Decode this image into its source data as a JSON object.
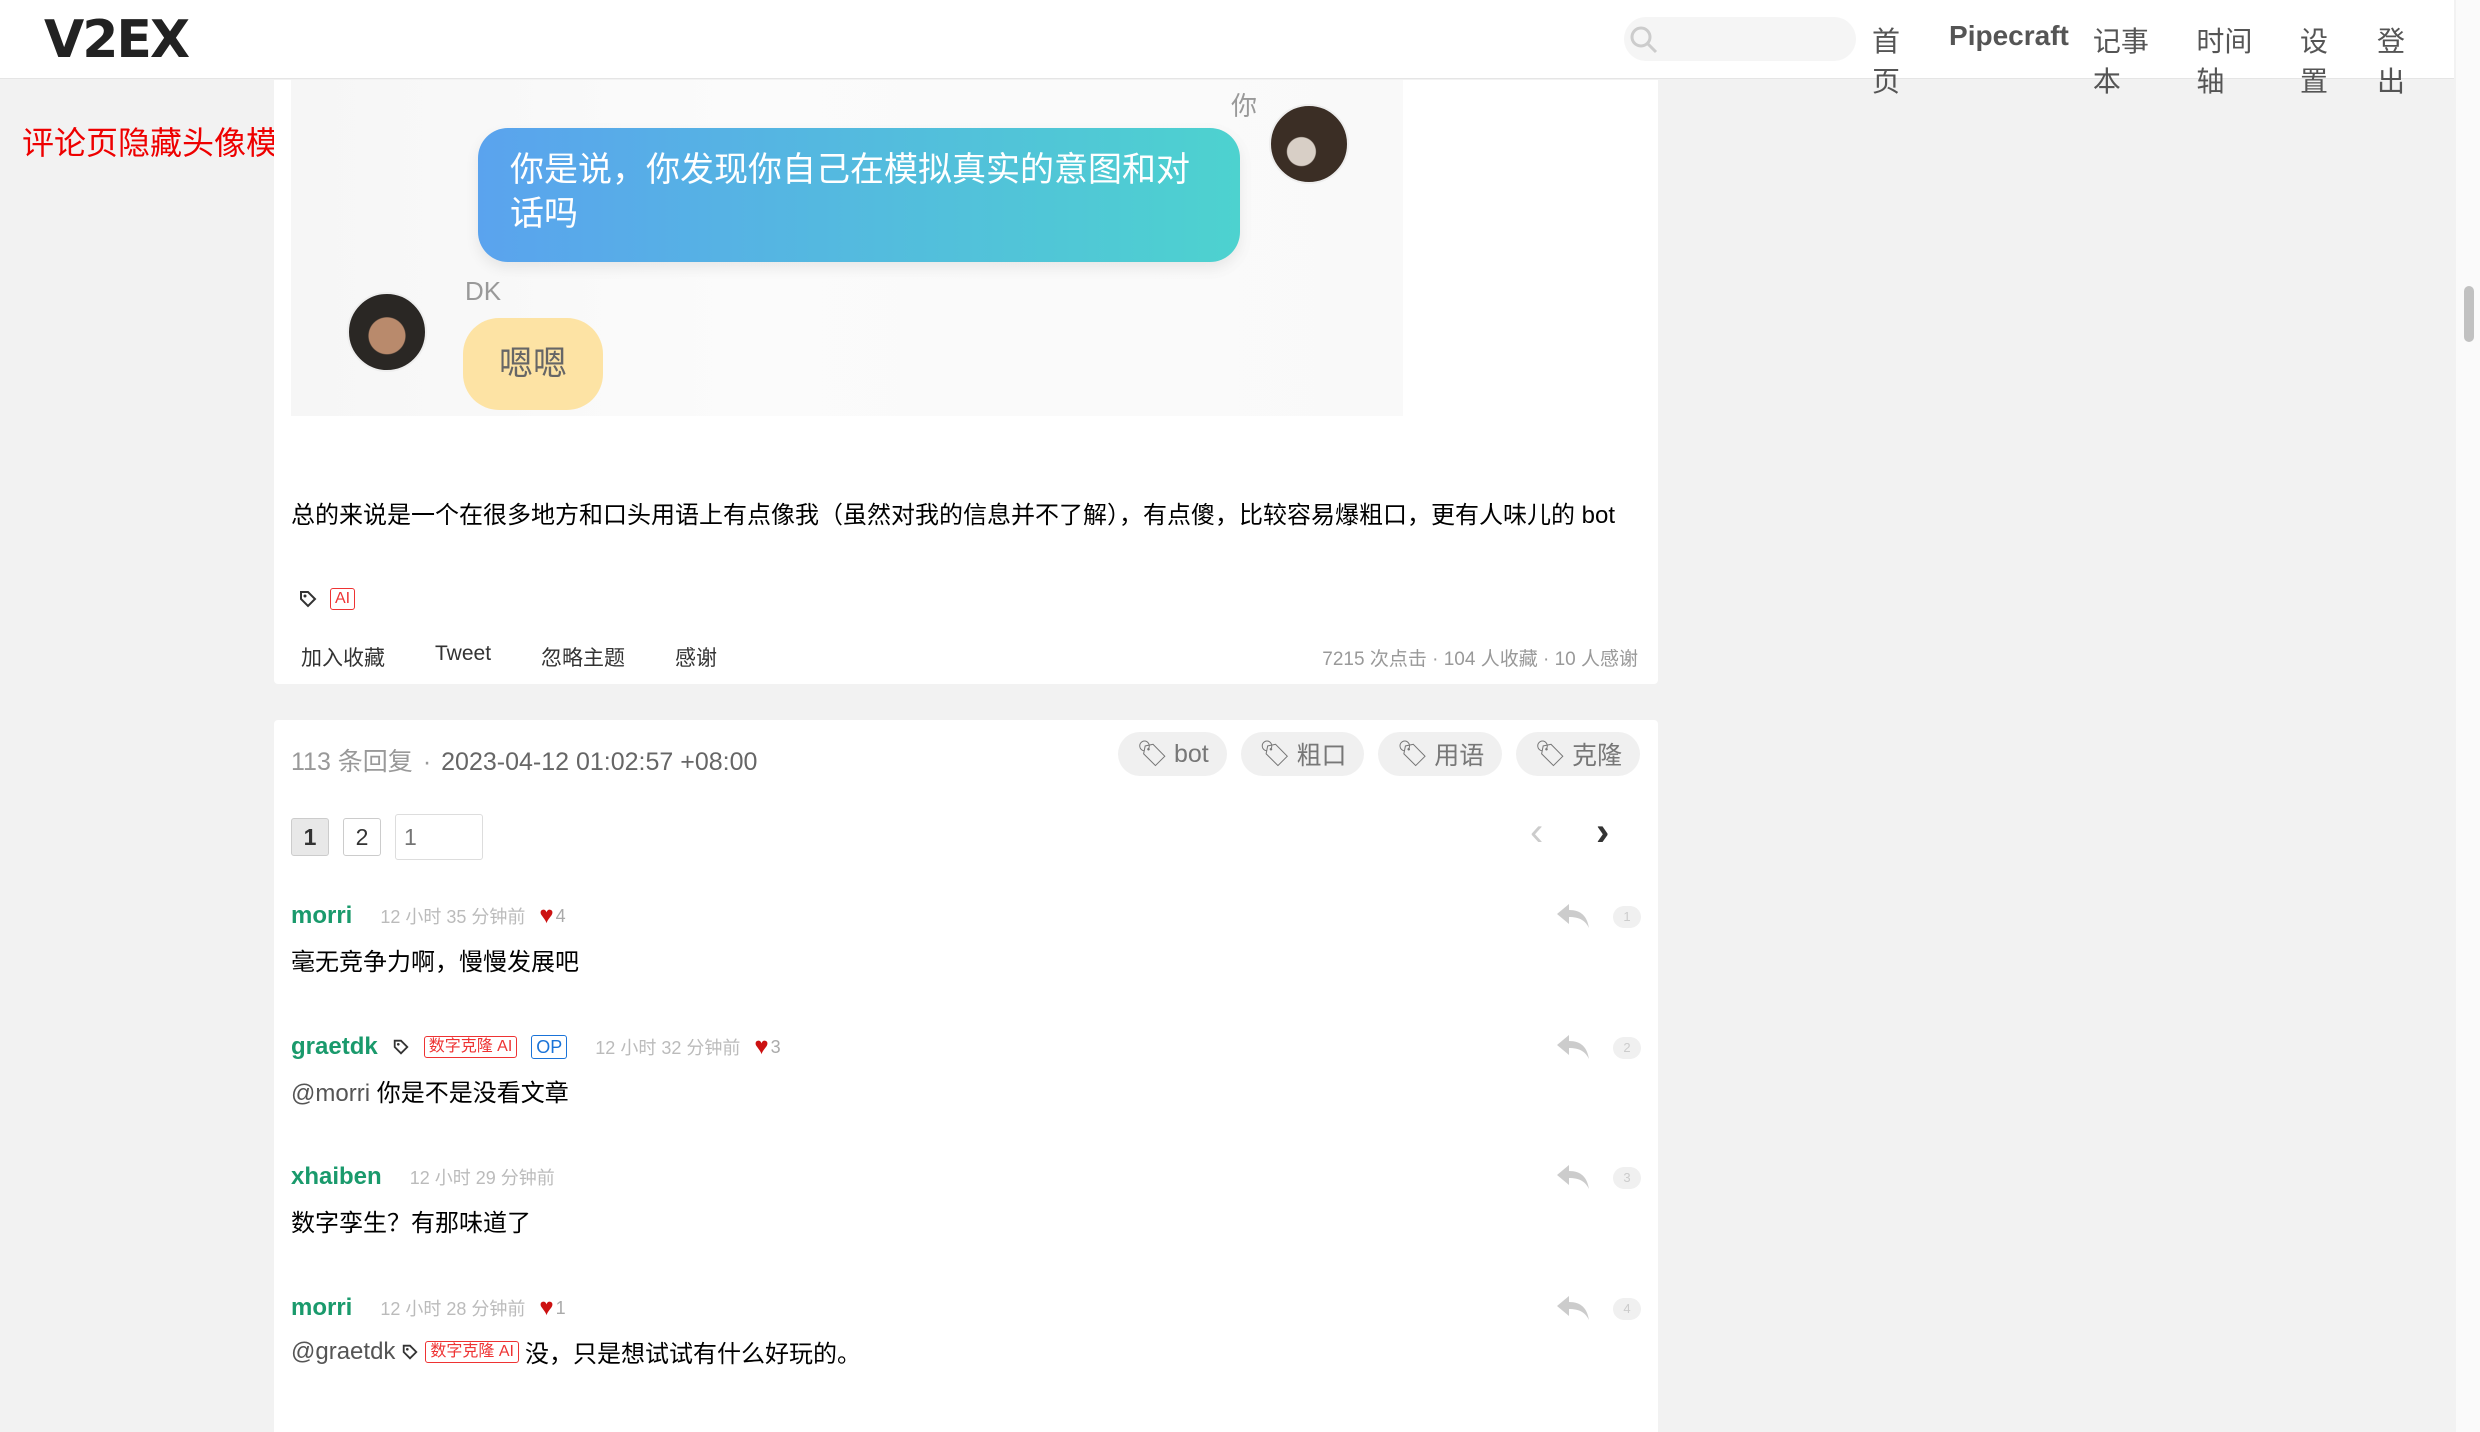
{
  "header": {
    "logo": "V2EX",
    "nav": [
      "首页",
      "Pipecraft",
      "记事本",
      "时间轴",
      "设置",
      "登出"
    ]
  },
  "annotation": "评论页隐藏头像模式",
  "chat": {
    "you_label": "你",
    "you_message": "你是说，你发现你自己在模拟真实的意图和对话吗",
    "dk_label": "DK",
    "dk_message": "嗯嗯"
  },
  "topic": {
    "content": "总的来说是一个在很多地方和口头用语上有点像我（虽然对我的信息并不了解），有点傻，比较容易爆粗口，更有人味儿的 bot",
    "tag": "AI",
    "actions": [
      "加入收藏",
      "Tweet",
      "忽略主题",
      "感谢"
    ],
    "stats": "7215 次点击  ·  104 人收藏  ·  10 人感谢"
  },
  "replies_header": {
    "count": "113 条回复",
    "date": "2023-04-12 01:02:57 +08:00",
    "tags": [
      "bot",
      "粗口",
      "用语",
      "克隆"
    ]
  },
  "pagination": {
    "pages": [
      "1",
      "2"
    ],
    "current": "1",
    "input_placeholder": "1"
  },
  "replies": [
    {
      "user": "morri",
      "ago": "12 小时 35 分钟前",
      "likes": "4",
      "text": "毫无竞争力啊，慢慢发展吧",
      "floor": "1"
    },
    {
      "user": "graetdk",
      "user_tag": "数字克隆 AI",
      "op": "OP",
      "ago": "12 小时 32 分钟前",
      "likes": "3",
      "at": "@morri",
      "text": " 你是不是没看文章",
      "floor": "2"
    },
    {
      "user": "xhaiben",
      "ago": "12 小时 29 分钟前",
      "text": "数字孪生？有那味道了",
      "floor": "3"
    },
    {
      "user": "morri",
      "ago": "12 小时 28 分钟前",
      "likes": "1",
      "at": "@graetdk",
      "at_tag": "数字克隆 AI",
      "text": " 没，只是想试试有什么好玩的。",
      "floor": "4"
    }
  ]
}
